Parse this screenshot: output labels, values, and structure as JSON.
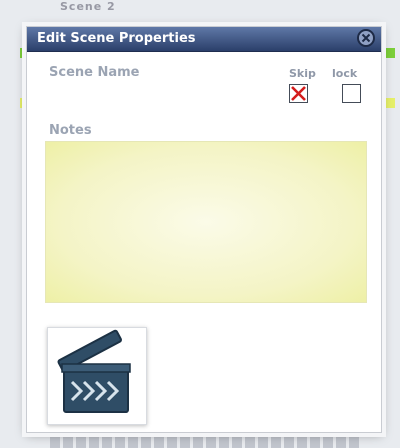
{
  "background": {
    "top_text": "Scene 2"
  },
  "dialog": {
    "title": "Edit Scene Properties",
    "scene_name_label": "Scene Name",
    "skip_label": "Skip",
    "lock_label": "lock",
    "skip_checked": true,
    "lock_checked": false,
    "notes_label": "Notes",
    "notes_value": ""
  },
  "icons": {
    "close": "close-circle-icon",
    "checkbox_x": "x-mark-icon",
    "thumbnail": "clapperboard-icon"
  },
  "colors": {
    "titlebar": "#3a4f7e",
    "notes_bg": "#f4f4c6",
    "skip_mark": "#d41c1c"
  }
}
